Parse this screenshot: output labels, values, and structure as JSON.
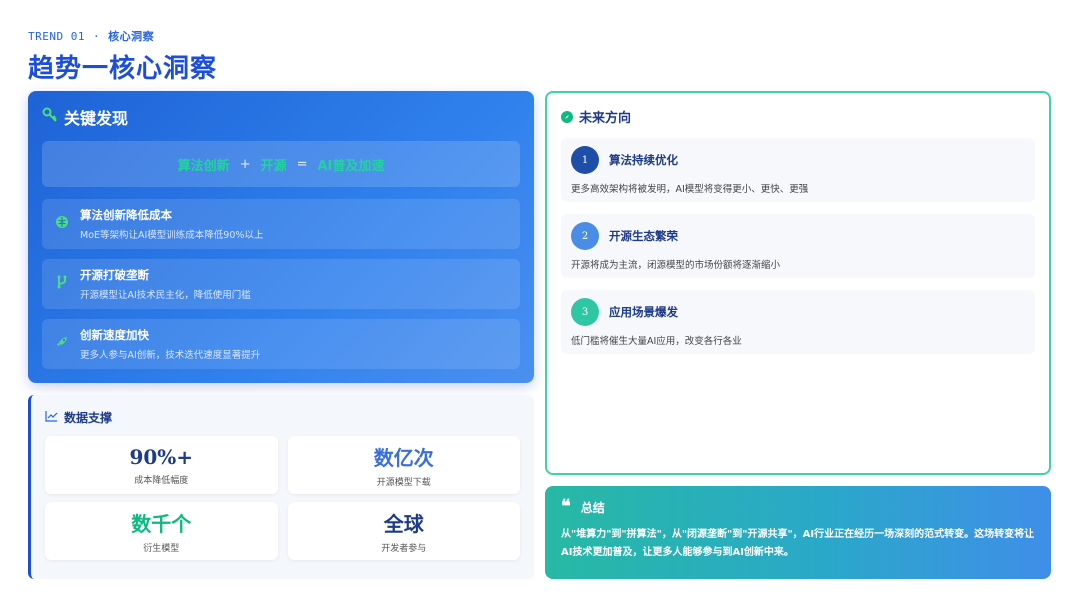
{
  "header": {
    "eyebrow_code": "TREND 01",
    "eyebrow_sep": "·",
    "eyebrow_label": "核心洞察",
    "title": "趋势一核心洞察"
  },
  "key_findings": {
    "title": "关键发现",
    "icon": "key-icon",
    "formula": {
      "term1": "算法创新",
      "op1": "+",
      "term2": "开源",
      "op2": "=",
      "term3": "AI普及加速"
    },
    "items": [
      {
        "icon": "brain-icon",
        "title": "算法创新降低成本",
        "desc": "MoE等架构让AI模型训练成本降低90%以上"
      },
      {
        "icon": "branch-icon",
        "title": "开源打破垄断",
        "desc": "开源模型让AI技术民主化，降低使用门槛"
      },
      {
        "icon": "rocket-icon",
        "title": "创新速度加快",
        "desc": "更多人参与AI创新，技术迭代速度显著提升"
      }
    ]
  },
  "data_support": {
    "title": "数据支撑",
    "icon": "chart-line-icon",
    "stats": [
      {
        "value": "90%+",
        "label": "成本降低幅度",
        "color": "#1e3a8a"
      },
      {
        "value": "数亿次",
        "label": "开源模型下载",
        "color": "#3b6fd8"
      },
      {
        "value": "数千个",
        "label": "衍生模型",
        "color": "#10b981"
      },
      {
        "value": "全球",
        "label": "开发者参与",
        "color": "#1e3a8a"
      }
    ]
  },
  "future": {
    "title": "未来方向",
    "icon": "compass-icon",
    "items": [
      {
        "num": "1",
        "title": "算法持续优化",
        "desc": "更多高效架构将被发明，AI模型将变得更小、更快、更强",
        "color": "#1e4ea8"
      },
      {
        "num": "2",
        "title": "开源生态繁荣",
        "desc": "开源将成为主流，闭源模型的市场份额将逐渐缩小",
        "color": "#4a8de6"
      },
      {
        "num": "3",
        "title": "应用场景爆发",
        "desc": "低门槛将催生大量AI应用，改变各行各业",
        "color": "#2fc7a3"
      }
    ]
  },
  "summary": {
    "title": "总结",
    "quote": "❝",
    "text": "从\"堆算力\"到\"拼算法\"，从\"闭源垄断\"到\"开源共享\"，AI行业正在经历一场深刻的范式转变。这场转变将让AI技术更加普及，让更多人能够参与到AI创新中来。"
  }
}
